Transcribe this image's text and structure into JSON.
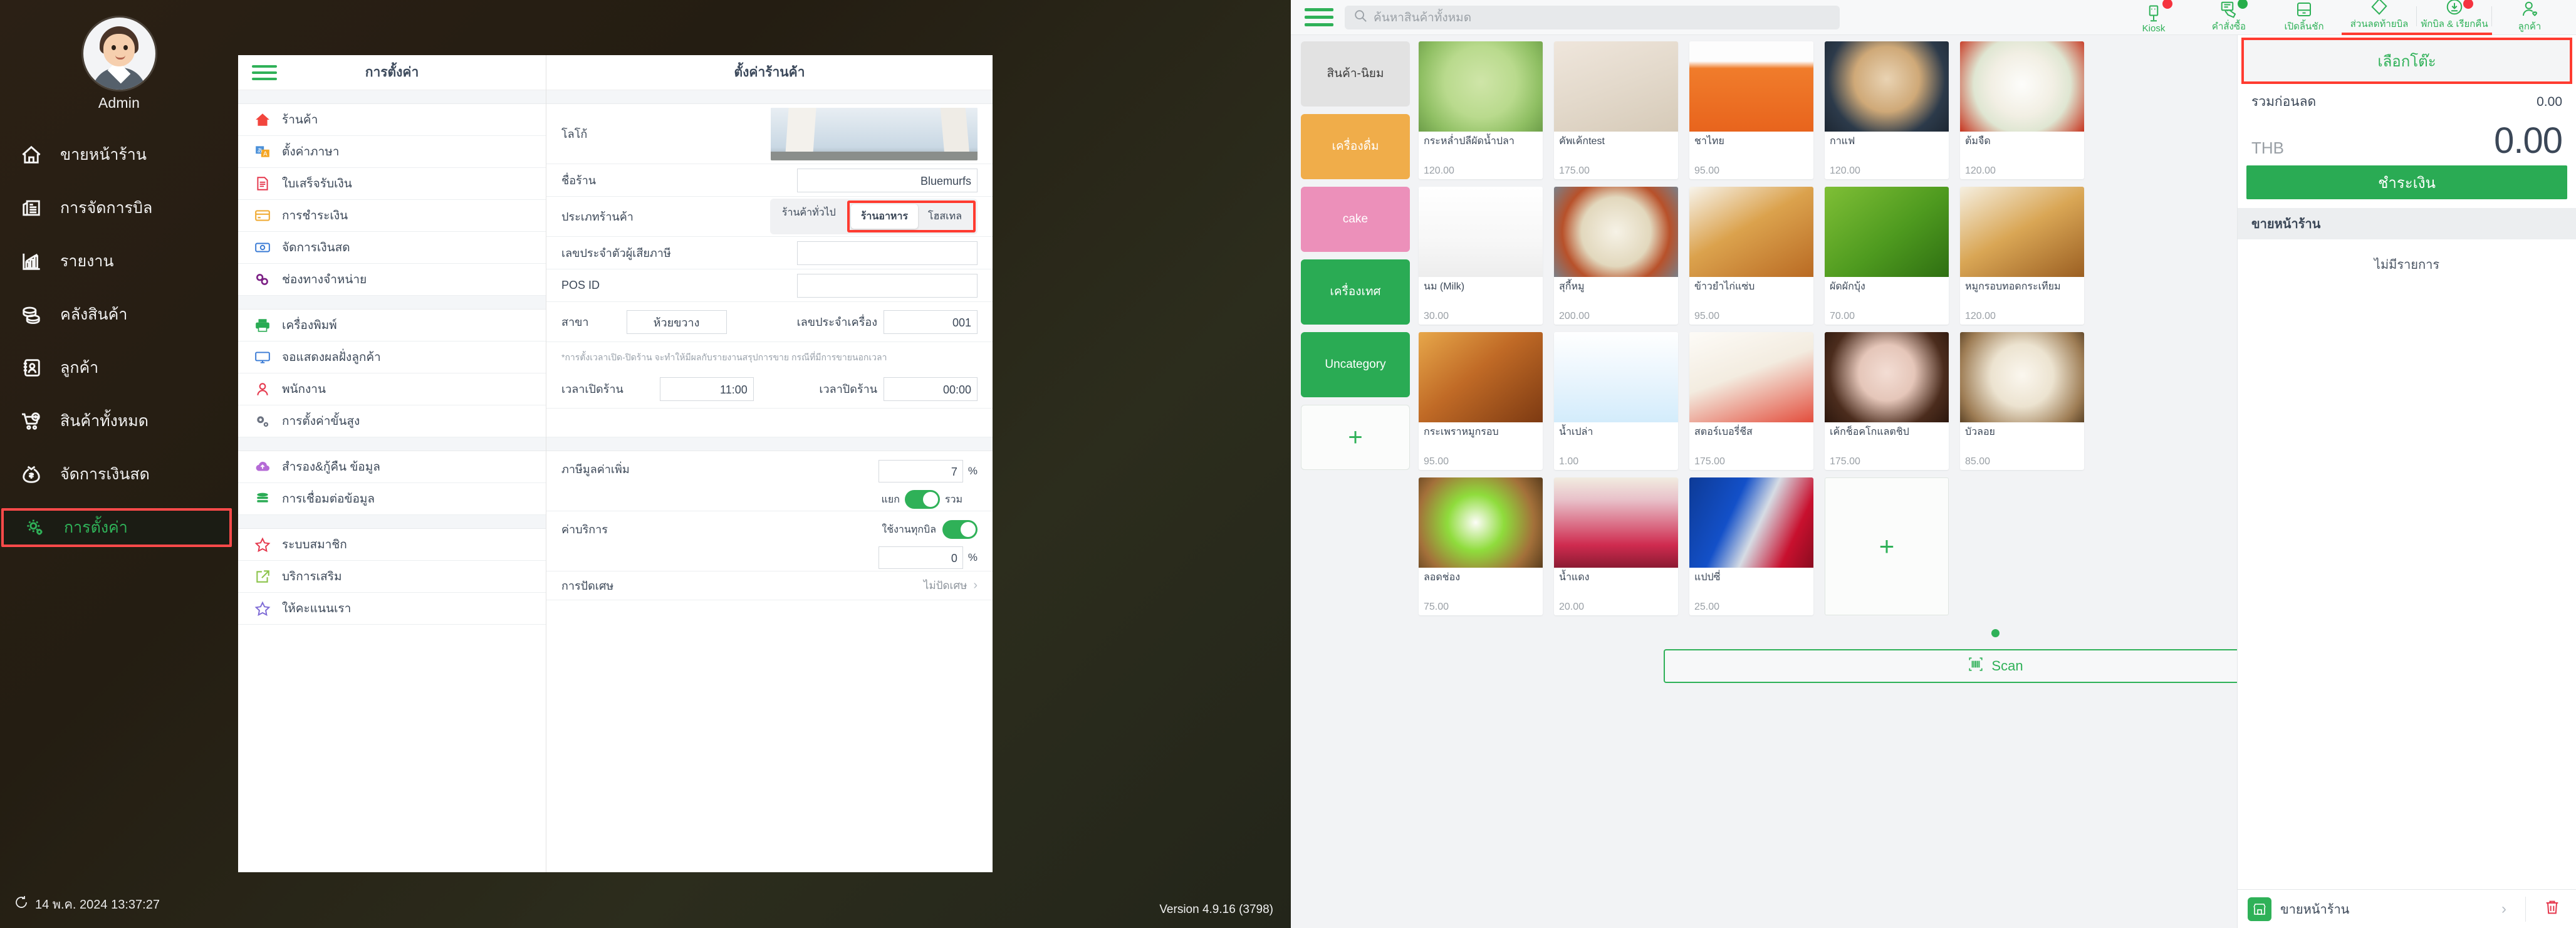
{
  "left_nav": {
    "profile_name": "Admin",
    "items": [
      {
        "label": "ขายหน้าร้าน",
        "icon": "home-icon"
      },
      {
        "label": "การจัดการบิล",
        "icon": "bills-icon"
      },
      {
        "label": "รายงาน",
        "icon": "report-chart-icon"
      },
      {
        "label": "คลังสินค้า",
        "icon": "stock-coins-icon"
      },
      {
        "label": "ลูกค้า",
        "icon": "customer-book-icon"
      },
      {
        "label": "สินค้าทั้งหมด",
        "icon": "cart-plus-icon"
      },
      {
        "label": "จัดการเงินสด",
        "icon": "money-bag-icon"
      },
      {
        "label": "การตั้งค่า",
        "icon": "gears-icon",
        "active": true
      }
    ],
    "clock": "14 พ.ค. 2024 13:37:27",
    "version": "Version 4.9.16 (3798)"
  },
  "settings_menu": {
    "title": "การตั้งค่า",
    "groups": [
      {
        "items": [
          {
            "label": "ร้านค้า",
            "icon": "home-red-icon"
          },
          {
            "label": "ตั้งค่าภาษา",
            "icon": "language-icon"
          },
          {
            "label": "ใบเสร็จรับเงิน",
            "icon": "receipt-icon"
          },
          {
            "label": "การชำระเงิน",
            "icon": "credit-card-icon"
          },
          {
            "label": "จัดการเงินสด",
            "icon": "banknote-icon"
          },
          {
            "label": "ช่องทางจำหน่าย",
            "icon": "link-chain-icon"
          }
        ]
      },
      {
        "items": [
          {
            "label": "เครื่องพิมพ์",
            "icon": "printer-icon"
          },
          {
            "label": "จอแสดงผลฝั่งลูกค้า",
            "icon": "monitor-icon"
          },
          {
            "label": "พนักงาน",
            "icon": "person-icon"
          },
          {
            "label": "การตั้งค่าขั้นสูง",
            "icon": "gears-icon"
          }
        ]
      },
      {
        "items": [
          {
            "label": "สำรอง&กู้คืน ข้อมูล",
            "icon": "cloud-upload-icon"
          },
          {
            "label": "การเชื่อมต่อข้อมูล",
            "icon": "database-icon"
          }
        ]
      },
      {
        "items": [
          {
            "label": "ระบบสมาชิก",
            "icon": "star-red-icon"
          },
          {
            "label": "บริการเสริม",
            "icon": "external-link-icon"
          },
          {
            "label": "ให้คะแนนเรา",
            "icon": "star-purple-icon"
          }
        ]
      }
    ]
  },
  "shop_settings": {
    "title": "ตั้งค่าร้านค้า",
    "logo_label": "โลโก้",
    "shop_name_label": "ชื่อร้าน",
    "shop_name_value": "Bluemurfs",
    "shop_type_label": "ประเภทร้านค้า",
    "shop_type_options": [
      "ร้านค้าทั่วไป",
      "ร้านอาหาร",
      "โฮสเทล"
    ],
    "shop_type_selected": "ร้านอาหาร",
    "tax_id_label": "เลขประจำตัวผู้เสียภาษี",
    "tax_id_value": "",
    "pos_id_label": "POS ID",
    "pos_id_value": "",
    "branch_label": "สาขา",
    "branch_value": "ห้วยขวาง",
    "device_no_label": "เลขประจำเครื่อง",
    "device_no_value": "001",
    "hours_note": "*การตั้งเวลาเปิด-ปิดร้าน จะทำให้มีผลกับรายงานสรุปการขาย กรณีที่มีการขายนอกเวลา",
    "open_time_label": "เวลาเปิดร้าน",
    "open_time_value": "11:00",
    "close_time_label": "เวลาปิดร้าน",
    "close_time_value": "00:00",
    "vat_label": "ภาษีมูลค่าเพิ่ม",
    "vat_value": "7",
    "vat_unit": "%",
    "vat_mode_left": "แยก",
    "vat_mode_right": "รวม",
    "service_label": "ค่าบริการ",
    "service_toggle_label": "ใช้งานทุกบิล",
    "service_value": "0",
    "service_unit": "%",
    "rounding_label": "การปัดเศษ",
    "rounding_value": "ไม่ปัดเศษ"
  },
  "pos": {
    "search_placeholder": "ค้นหาสินค้าทั้งหมด",
    "top_actions": [
      {
        "label": "Kiosk",
        "icon": "kiosk-icon",
        "badge": "red"
      },
      {
        "label": "คำสั่งซื้อ",
        "icon": "order-hand-icon",
        "badge": "green"
      },
      {
        "label": "เปิดลิ้นชัก",
        "icon": "cash-drawer-icon"
      },
      {
        "label": "ส่วนลดท้ายบิล",
        "icon": "discount-tag-icon"
      },
      {
        "label": "พักบิล & เรียกคืน",
        "icon": "hold-bill-icon",
        "badge": "red"
      },
      {
        "label": "ลูกค้า",
        "icon": "customer-heart-icon"
      }
    ],
    "categories": [
      {
        "label": "สินค้า-นิยม",
        "color": "#e2e2e2",
        "text": "#3a3a3a"
      },
      {
        "label": "เครื่องดื่ม",
        "color": "#f0ad4a",
        "text": "#ffffff"
      },
      {
        "label": "cake",
        "color": "#ec90ba",
        "text": "#ffffff"
      },
      {
        "label": "เครื่องเทศ",
        "color": "#2aab54",
        "text": "#ffffff"
      },
      {
        "label": "Uncategory",
        "color": "#2aab54",
        "text": "#ffffff"
      },
      {
        "label": "+",
        "color": "#fbfcfb",
        "text": "#2fb158",
        "is_add": true
      }
    ],
    "products": [
      {
        "name": "กระหล่ำปลีผัดน้ำปลา",
        "price": "120.00",
        "art": "cabbage"
      },
      {
        "name": "คัพเค้กtest",
        "price": "175.00",
        "art": "cupcakes"
      },
      {
        "name": "ชาไทย",
        "price": "95.00",
        "art": "thaitea"
      },
      {
        "name": "กาแฟ",
        "price": "120.00",
        "art": "coffee"
      },
      {
        "name": "ต้มจืด",
        "price": "120.00",
        "art": "tomjued"
      },
      {
        "name": "นม (Milk)",
        "price": "30.00",
        "art": "milk"
      },
      {
        "name": "สุกี้หมู",
        "price": "200.00",
        "art": "sukiimoo"
      },
      {
        "name": "ข้าวยำไก่แซ่บ",
        "price": "95.00",
        "art": "yamkai"
      },
      {
        "name": "ผัดผักบุ้ง",
        "price": "70.00",
        "art": "morning"
      },
      {
        "name": "หมูกรอบทอดกระเทียม",
        "price": "120.00",
        "art": "mookrob"
      },
      {
        "name": "กระเพราหมูกรอบ",
        "price": "95.00",
        "art": "kaprao"
      },
      {
        "name": "น้ำเปล่า",
        "price": "1.00",
        "art": "water"
      },
      {
        "name": "สตอร์เบอรี่ชีส",
        "price": "175.00",
        "art": "strawcake"
      },
      {
        "name": "เค้กช็อคโกแลตชิป",
        "price": "175.00",
        "art": "choccake"
      },
      {
        "name": "บัวลอย",
        "price": "85.00",
        "art": "buoaloy"
      },
      {
        "name": "ลอดช่อง",
        "price": "75.00",
        "art": "lodchong"
      },
      {
        "name": "น้ำแดง",
        "price": "20.00",
        "art": "namdaeng"
      },
      {
        "name": "แปปซี่",
        "price": "25.00",
        "art": "pepsi"
      }
    ],
    "add_product_label": "+",
    "scan_label": "Scan"
  },
  "summary": {
    "select_table_label": "เลือกโต๊ะ",
    "subtotal_label": "รวมก่อนลด",
    "subtotal_value": "0.00",
    "currency": "THB",
    "total_value": "0.00",
    "pay_label": "ชำระเงิน",
    "section_label": "ขายหน้าร้าน",
    "empty_label": "ไม่มีรายการ",
    "footer_label": "ขายหน้าร้าน"
  }
}
